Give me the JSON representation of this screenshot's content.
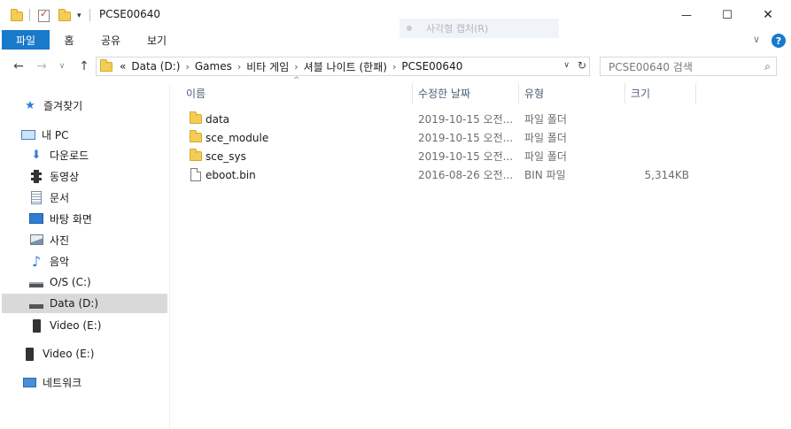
{
  "window": {
    "title": "PCSE00640",
    "minimize_glyph": "—",
    "maximize_glyph": "☐",
    "close_glyph": "✕"
  },
  "ribbon": {
    "tabs": [
      "파일",
      "홈",
      "공유",
      "보기"
    ],
    "ghost_button": "사각형 캡처(R)",
    "help_glyph": "?",
    "collapse_glyph": "∨"
  },
  "nav": {
    "back": "←",
    "forward": "→",
    "dropdown": "∨",
    "up": "↑"
  },
  "address": {
    "overflow": "«",
    "crumbs": [
      "Data (D:)",
      "Games",
      "비타 게임",
      "셔블 나이트 (한패)",
      "PCSE00640"
    ],
    "separator": "›",
    "dropdown_glyph": "∨",
    "refresh_glyph": "↻"
  },
  "search": {
    "placeholder": "PCSE00640 검색",
    "icon": "⌕"
  },
  "sidebar": {
    "items": [
      {
        "label": "즐겨찾기",
        "icon": "star-icon",
        "glyph": "★",
        "color": "#2f7cd3"
      },
      {
        "label": "내 PC",
        "icon": "computer-icon",
        "glyph": "🖥",
        "color": "#2f7cd3"
      },
      {
        "label": "다운로드",
        "icon": "download-icon",
        "glyph": "⬇",
        "color": "#2f7cd3"
      },
      {
        "label": "동영상",
        "icon": "video-icon",
        "glyph": "▦",
        "color": "#333333"
      },
      {
        "label": "문서",
        "icon": "document-icon",
        "glyph": "▤",
        "color": "#5a6a80"
      },
      {
        "label": "바탕 화면",
        "icon": "desktop-icon",
        "glyph": "▬",
        "color": "#2f7cd3"
      },
      {
        "label": "사진",
        "icon": "pictures-icon",
        "glyph": "▭",
        "color": "#5a6a80"
      },
      {
        "label": "음악",
        "icon": "music-icon",
        "glyph": "♪",
        "color": "#2f7cd3"
      },
      {
        "label": "O/S (C:)",
        "icon": "drive-c-icon",
        "glyph": "▬",
        "color": "#555555"
      },
      {
        "label": "Data (D:)",
        "icon": "drive-d-icon",
        "glyph": "▬",
        "color": "#555555"
      },
      {
        "label": "Video (E:)",
        "icon": "drive-e-icon",
        "glyph": "▮",
        "color": "#333333"
      },
      {
        "label": "Video (E:)",
        "icon": "removable-drive-icon",
        "glyph": "▮",
        "color": "#333333"
      },
      {
        "label": "네트워크",
        "icon": "network-icon",
        "glyph": "🖧",
        "color": "#2f7cd3"
      }
    ]
  },
  "columns": {
    "name": "이름",
    "modified": "수정한 날짜",
    "type": "유형",
    "size": "크기",
    "sort_glyph": "^"
  },
  "files": [
    {
      "name": "data",
      "modified": "2019-10-15 오전...",
      "type": "파일 폴더",
      "size": "",
      "icon": "folder-icon"
    },
    {
      "name": "sce_module",
      "modified": "2019-10-15 오전...",
      "type": "파일 폴더",
      "size": "",
      "icon": "folder-icon"
    },
    {
      "name": "sce_sys",
      "modified": "2019-10-15 오전...",
      "type": "파일 폴더",
      "size": "",
      "icon": "folder-icon"
    },
    {
      "name": "eboot.bin",
      "modified": "2016-08-26 오전...",
      "type": "BIN 파일",
      "size": "5,314KB",
      "icon": "file-icon"
    }
  ],
  "colors": {
    "accent": "#1979ca",
    "selection": "#d9d9d9",
    "header_text": "#4c607a",
    "folder": "#f3cd55"
  }
}
